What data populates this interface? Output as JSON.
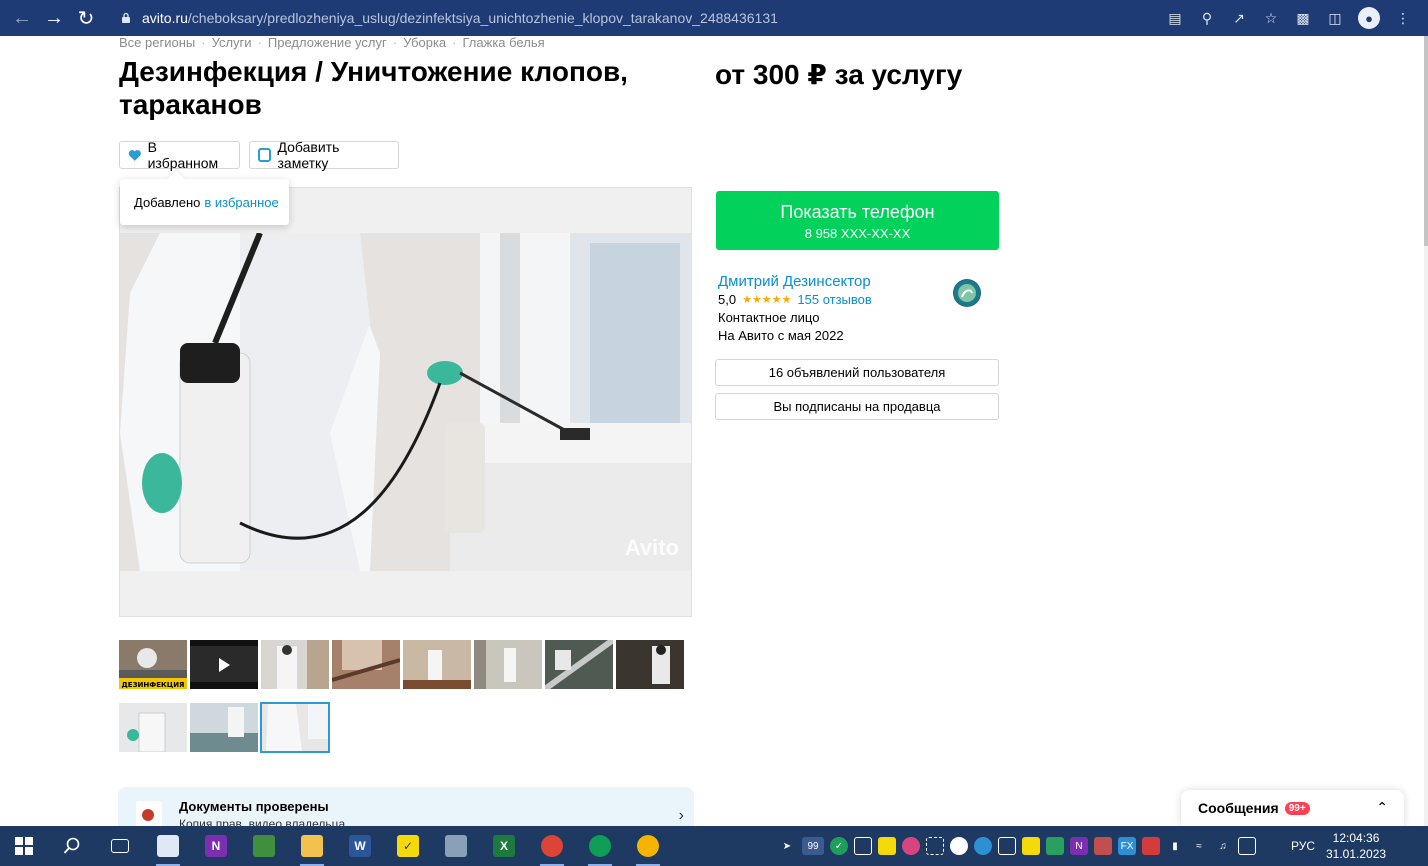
{
  "browser": {
    "url_host": "avito.ru",
    "url_path": "/cheboksary/predlozheniya_uslug/dezinfektsiya_unichtozhenie_klopov_tarakanov_2488436131"
  },
  "breadcrumbs": [
    "Все регионы",
    "Услуги",
    "Предложение услуг",
    "Уборка",
    "Глажка белья"
  ],
  "listing": {
    "title": "Дезинфекция / Уничтожение клопов, тараканов",
    "price": "от 300 ₽ за услугу",
    "favorite_label": "В избранном",
    "note_label": "Добавить заметку",
    "tooltip_text": "Добавлено",
    "tooltip_link": "в избранное",
    "watermark": "Avito",
    "thumb_overlay_text": "ДЕЗИНФЕКЦИЯ"
  },
  "contact": {
    "phone_button": "Показать телефон",
    "phone_masked": "8 958 XXX-XX-XX",
    "seller_name": "Дмитрий Дезинсектор",
    "rating": "5,0",
    "stars": "★★★★★",
    "reviews": "155 отзывов",
    "role": "Контактное лицо",
    "since": "На Авито с мая 2022",
    "ads_button": "16 объявлений пользователя",
    "subscribe_button": "Вы подписаны на продавца"
  },
  "docs": {
    "title": "Документы проверены",
    "subtitle": "Копия прав, видео владельца"
  },
  "messages": {
    "label": "Сообщения",
    "badge": "99+"
  },
  "taskbar": {
    "tray_badge": "99",
    "language": "РУС",
    "time": "12:04:36",
    "date": "31.01.2023"
  },
  "colors": {
    "chrome": "#1f3b75",
    "accent_blue": "#0a8fd0",
    "phone_green": "#02d15c",
    "taskbar": "#1e3962"
  }
}
